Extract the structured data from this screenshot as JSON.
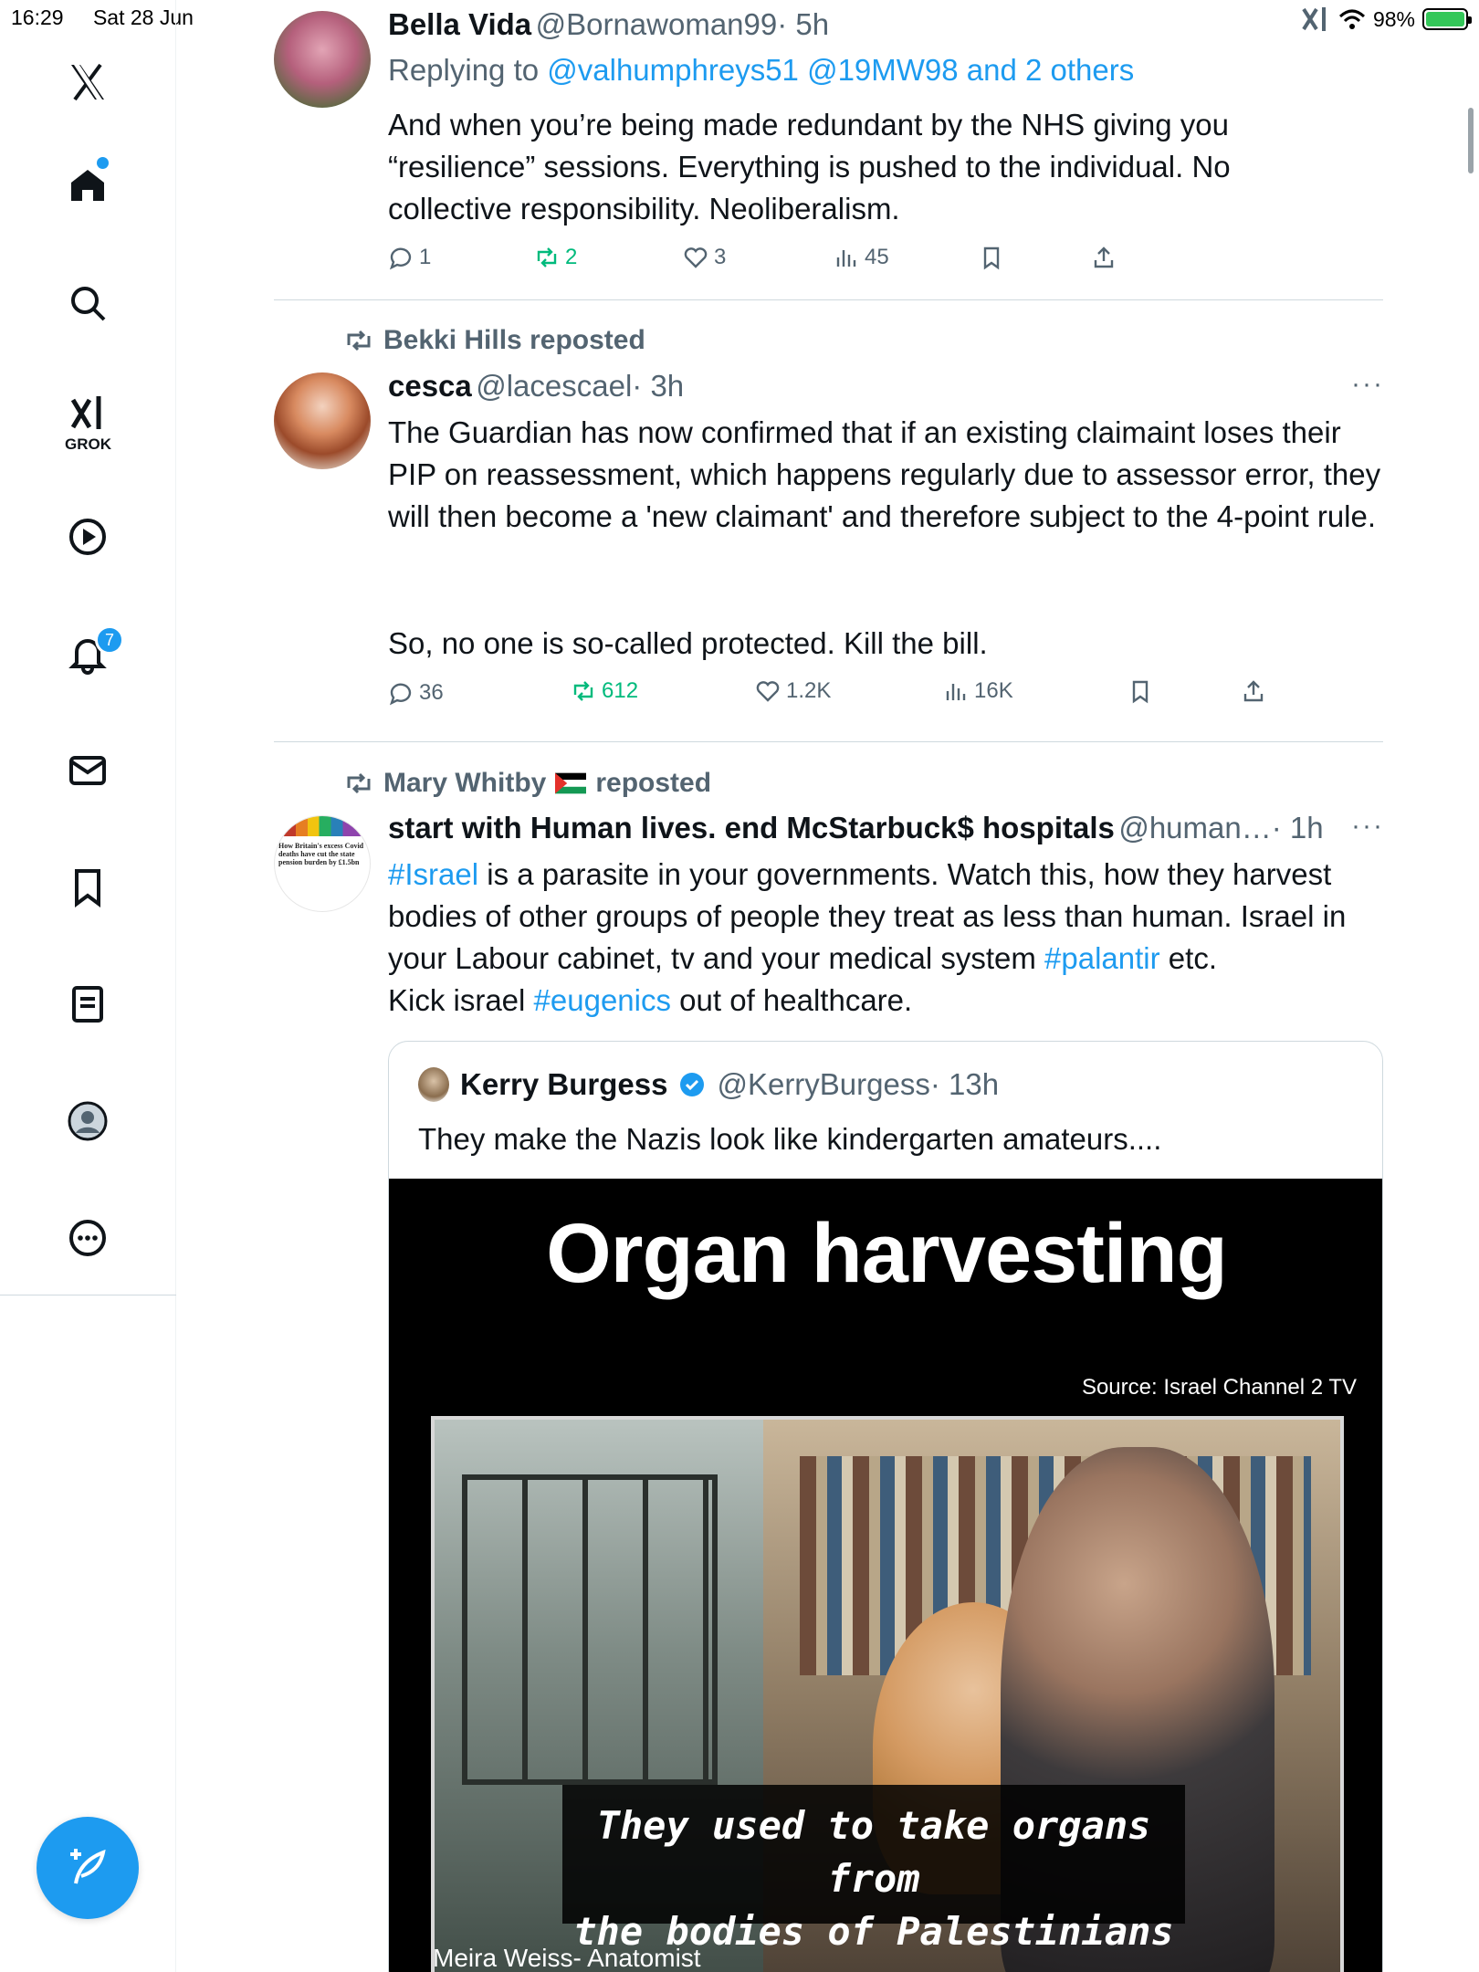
{
  "status_bar": {
    "time": "16:29",
    "date": "Sat 28 Jun",
    "battery": "98%"
  },
  "sidebar": {
    "grok_label": "GROK",
    "notifications_badge": "7",
    "items": [
      "x-logo",
      "home",
      "search",
      "grok",
      "video",
      "notifications",
      "messages",
      "bookmarks",
      "lists",
      "profile",
      "more"
    ]
  },
  "tweets": [
    {
      "name": "Bella Vida",
      "handle": "@Bornawoman99",
      "time": "· 5h",
      "replying_prefix": "Replying to ",
      "replying_to": "@valhumphreys51 @19MW98 and 2 others",
      "text": "And when you’re being made redundant by the NHS giving you “resilience” sessions. Everything is pushed to the individual. No collective responsibility. Neoliberalism.",
      "replies": "1",
      "reposts": "2",
      "likes": "3",
      "views": "45"
    },
    {
      "reposted_by": "Bekki Hills reposted",
      "name": "cesca",
      "handle": "@lacescael",
      "time": "· 3h",
      "text_p1": "The Guardian has now confirmed that if an existing claimaint loses their PIP on reassessment, which happens regularly due to assessor error, they will then become a 'new claimant' and therefore subject to the 4-point rule.",
      "text_p2": "So, no one is so-called protected. Kill the bill.",
      "replies": "36",
      "reposts": "612",
      "likes": "1.2K",
      "views": "16K"
    },
    {
      "reposted_by_name": "Mary Whitby",
      "reposted_by_suffix": "reposted",
      "name": "start with Human lives. end McStarbuck$ hospitals",
      "handle": "@human…",
      "time": "· 1h",
      "hashtag1": "#Israel",
      "text_a": " is a parasite in your governments. Watch this, how they harvest bodies of other groups of people they treat as less than human. Israel in your Labour cabinet, tv and your medical system ",
      "hashtag2": "#palantir",
      "text_b": " etc.",
      "text_c": "Kick israel ",
      "hashtag3": "#eugenics",
      "text_d": " out of healthcare.",
      "avatar_text": "How Britain's excess Covid deaths have cut the state pension burden by £1.5bn",
      "quote": {
        "name": "Kerry Burgess",
        "handle": "@KerryBurgess",
        "time": "· 13h",
        "text": "They make the Nazis look like kindergarten amateurs....",
        "media_title": "Organ harvesting",
        "media_source": "Source: Israel Channel 2 TV",
        "subtitle_line1": "They used to take organs from",
        "subtitle_line2": "the bodies of Palestinians",
        "caption": "Meira Weiss- Anatomist"
      }
    }
  ],
  "colors": {
    "accent": "#1d9bf0",
    "repost_green": "#00ba7c",
    "muted": "#536471"
  }
}
